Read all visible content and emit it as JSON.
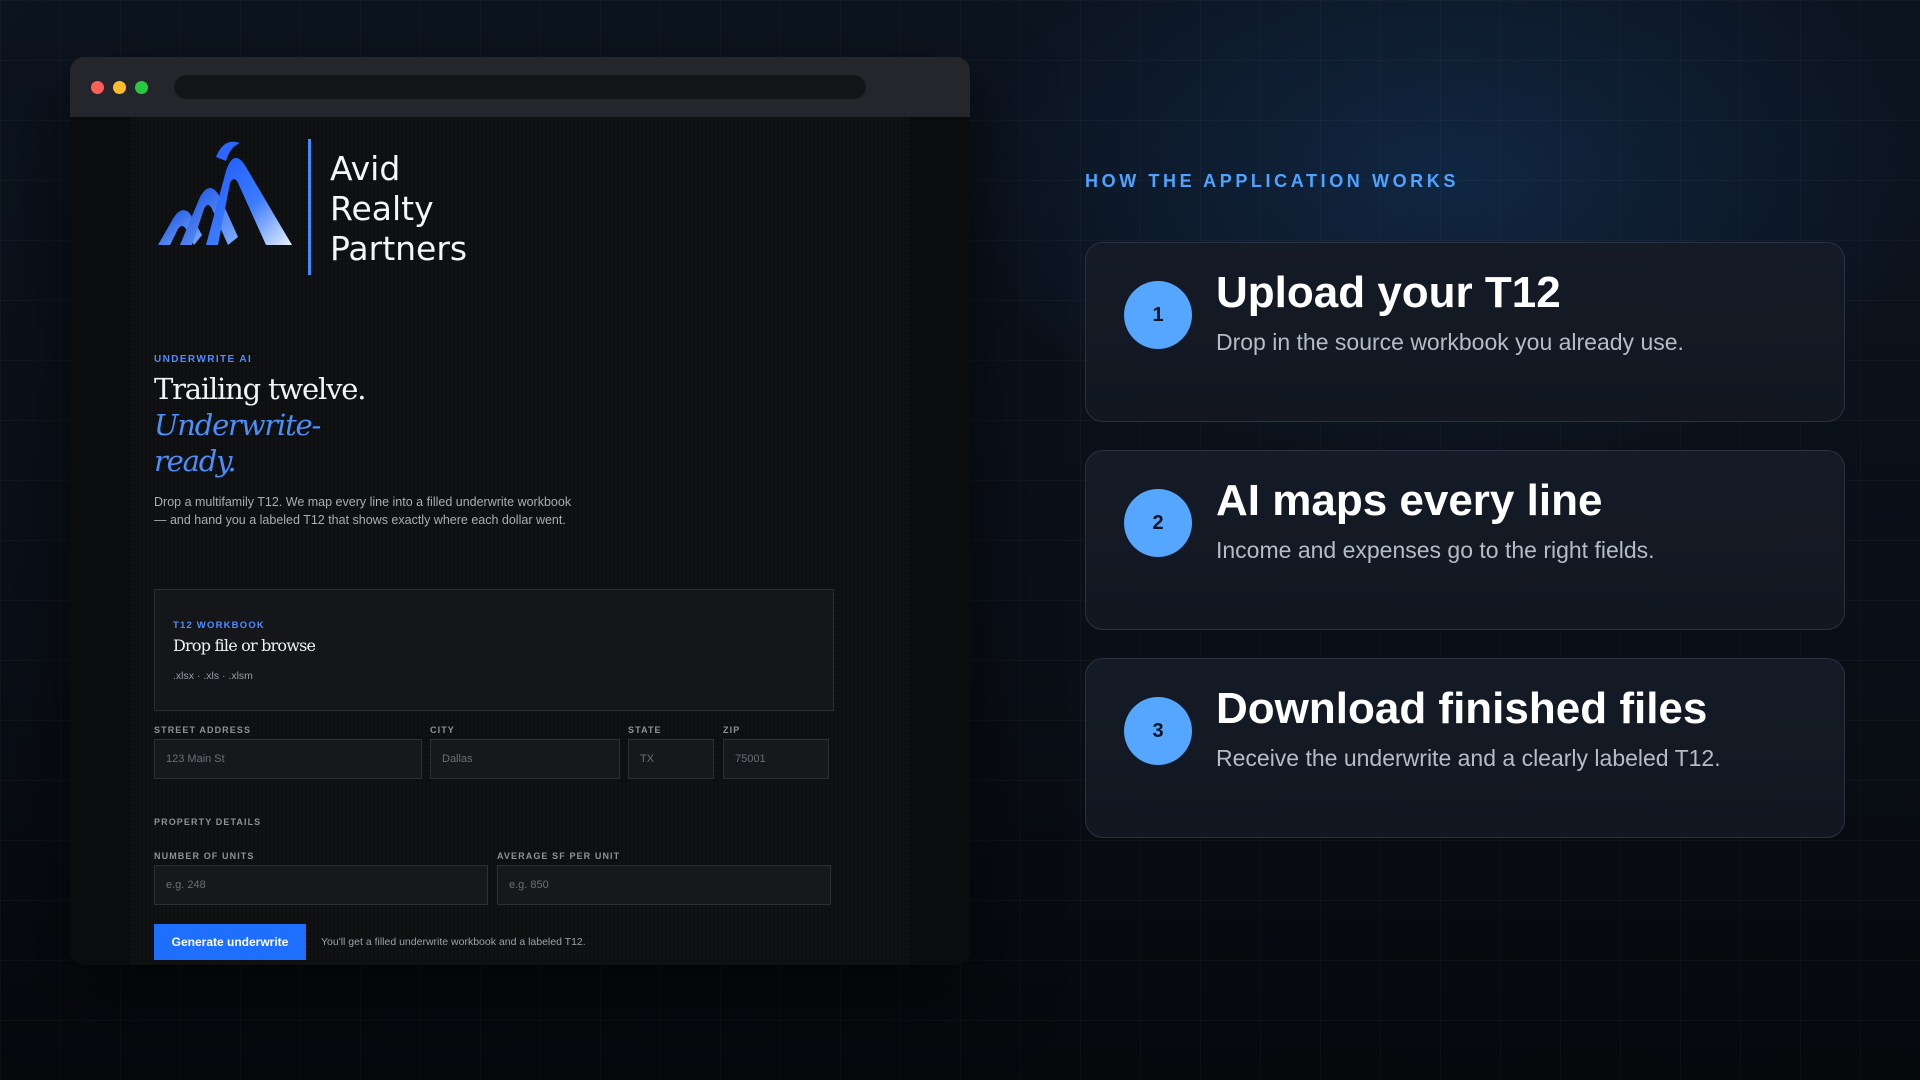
{
  "window": {
    "controls": [
      "close",
      "minimize",
      "maximize"
    ]
  },
  "brand": {
    "name_lines": [
      "Avid",
      "Realty",
      "Partners"
    ],
    "logo_icon": "stacked-chevron-logo",
    "accent_color": "#3e8dff"
  },
  "hero": {
    "eyebrow": "UNDERWRITE AI",
    "headline_line1": "Trailing twelve.",
    "headline_line2": "Underwrite-",
    "headline_line3": "ready.",
    "description": "Drop a multifamily T12. We map every line into a filled underwrite workbook — and hand you a labeled T12 that shows exactly where each dollar went."
  },
  "dropzone": {
    "label": "T12 WORKBOOK",
    "title": "Drop file or browse",
    "formats": ".xlsx · .xls · .xlsm"
  },
  "address": {
    "street": {
      "label": "STREET ADDRESS",
      "placeholder": "123 Main St",
      "value": ""
    },
    "city": {
      "label": "CITY",
      "placeholder": "Dallas",
      "value": ""
    },
    "state": {
      "label": "STATE",
      "placeholder": "TX",
      "value": ""
    },
    "zip": {
      "label": "ZIP",
      "placeholder": "75001",
      "value": ""
    }
  },
  "property": {
    "section_label": "PROPERTY DETAILS",
    "units": {
      "label": "NUMBER OF UNITS",
      "placeholder": "e.g. 248",
      "value": ""
    },
    "avg_sf": {
      "label": "AVERAGE SF PER UNIT",
      "placeholder": "e.g. 850",
      "value": ""
    }
  },
  "actions": {
    "generate_label": "Generate underwrite",
    "generate_note": "You'll get a filled underwrite workbook and a labeled T12.",
    "button_color": "#1f6fff"
  },
  "how": {
    "title": "HOW THE APPLICATION WORKS",
    "accent_color": "#4fa3ff",
    "steps": [
      {
        "number": "1",
        "title": "Upload your T12",
        "description": "Drop in the source workbook you already use."
      },
      {
        "number": "2",
        "title": "AI maps every line",
        "description": "Income and expenses go to the right fields."
      },
      {
        "number": "3",
        "title": "Download finished files",
        "description": "Receive the underwrite and a clearly labeled T12."
      }
    ]
  }
}
